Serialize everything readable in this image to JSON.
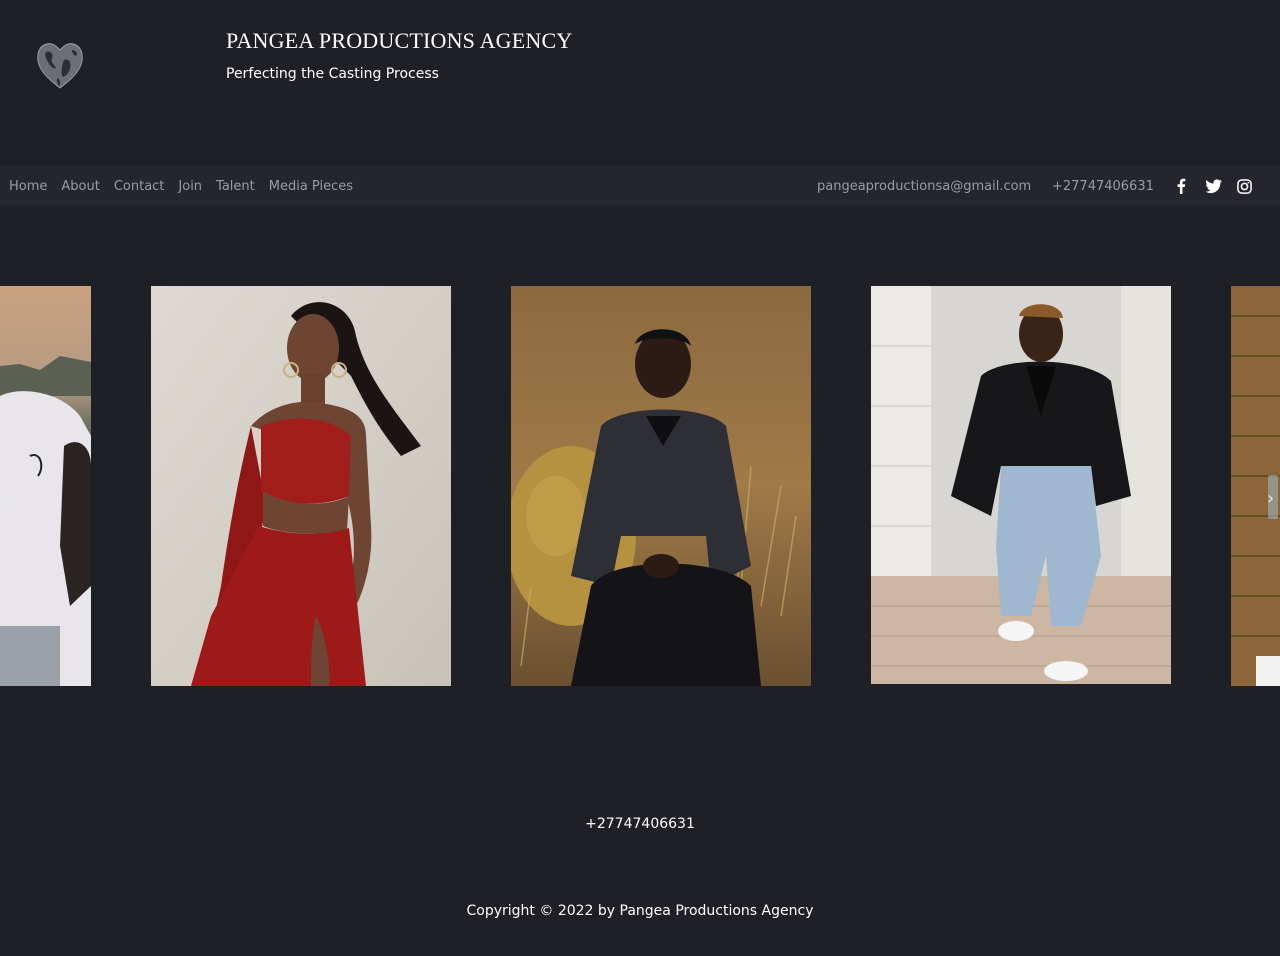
{
  "header": {
    "title": "PANGEA PRODUCTIONS AGENCY",
    "tagline": "Perfecting the Casting Process",
    "logo_icon": "heart-world-map-logo"
  },
  "nav": {
    "items": [
      {
        "label": "Home"
      },
      {
        "label": "About"
      },
      {
        "label": "Contact"
      },
      {
        "label": "Join"
      },
      {
        "label": "Talent"
      },
      {
        "label": "Media Pieces"
      }
    ],
    "email": "pangeaproductionsa@gmail.com",
    "phone": "+27747406631",
    "social": [
      "facebook-icon",
      "twitter-icon",
      "instagram-icon"
    ]
  },
  "carousel": {
    "prev_label": "‹",
    "next_label": "›",
    "slides": [
      {
        "name": "talent-photo-man-white-tshirt"
      },
      {
        "name": "talent-photo-woman-red-outfit"
      },
      {
        "name": "talent-photo-man-denim-jacket"
      },
      {
        "name": "talent-photo-man-leather-jacket"
      },
      {
        "name": "talent-photo-partial-wood"
      }
    ]
  },
  "footer": {
    "phone": "+27747406631",
    "copyright": "Copyright © 2022 by Pangea Productions Agency"
  },
  "colors": {
    "background": "#1f2026",
    "navbar": "#25262d",
    "nav_text": "#9a9ba1",
    "text": "#ffffff"
  }
}
